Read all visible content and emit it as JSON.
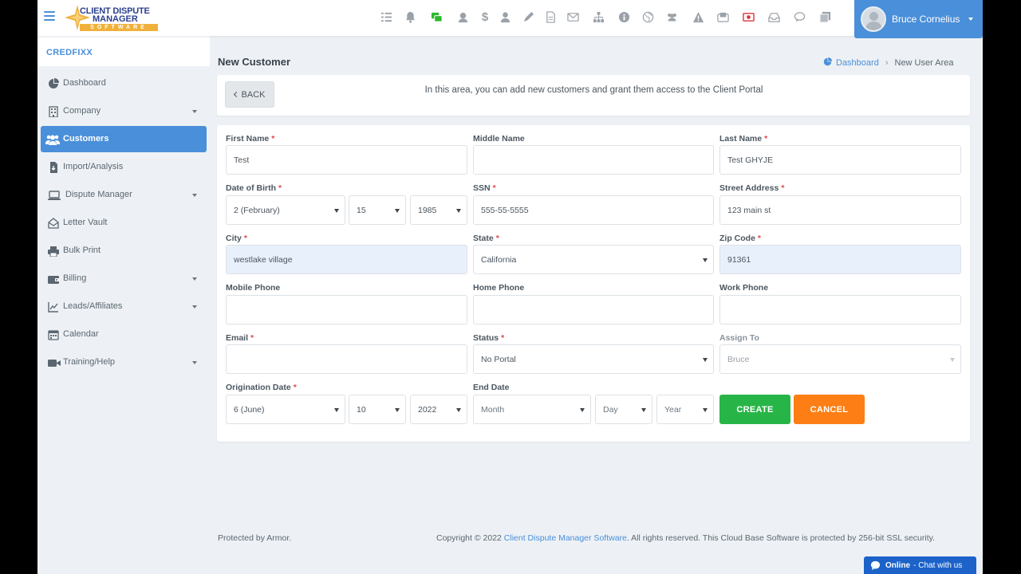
{
  "header": {
    "logo_line1": "CLIENT DISPUTE",
    "logo_line2": "MANAGER",
    "logo_line3": "SOFTWARE",
    "user_name": "Bruce Cornelius",
    "icons": [
      "tasks-icon",
      "bell-icon",
      "disputes-icon",
      "agent-icon",
      "dollar-icon",
      "user-tie-icon",
      "pen-icon",
      "file-icon",
      "envelope-icon",
      "sitemap-icon",
      "info-icon",
      "globe-icon",
      "users-icon",
      "warning-icon",
      "mail-box-icon",
      "money-icon",
      "inbox-icon",
      "comments-icon",
      "copy-icon"
    ]
  },
  "sidebar": {
    "brand": "CREDFIXX",
    "items": [
      {
        "label": "Dashboard",
        "icon": "pie-chart-icon",
        "has_caret": false,
        "active": false
      },
      {
        "label": "Company",
        "icon": "building-icon",
        "has_caret": true,
        "active": false
      },
      {
        "label": "Customers",
        "icon": "users-icon",
        "has_caret": false,
        "active": true
      },
      {
        "label": "Import/Analysis",
        "icon": "file-import-icon",
        "has_caret": false,
        "active": false
      },
      {
        "label": "Dispute Manager",
        "icon": "laptop-icon",
        "has_caret": true,
        "active": false
      },
      {
        "label": "Letter Vault",
        "icon": "envelope-open-icon",
        "has_caret": false,
        "active": false
      },
      {
        "label": "Bulk Print",
        "icon": "print-icon",
        "has_caret": false,
        "active": false
      },
      {
        "label": "Billing",
        "icon": "wallet-icon",
        "has_caret": true,
        "active": false
      },
      {
        "label": "Leads/Affiliates",
        "icon": "chart-line-icon",
        "has_caret": true,
        "active": false
      },
      {
        "label": "Calendar",
        "icon": "calendar-icon",
        "has_caret": false,
        "active": false
      },
      {
        "label": "Training/Help",
        "icon": "video-icon",
        "has_caret": true,
        "active": false
      }
    ]
  },
  "page": {
    "title": "New Customer",
    "breadcrumb": {
      "home": "Dashboard",
      "current": "New User Area"
    },
    "back_label": "BACK",
    "info_text": "In this area, you can add new customers and grant them access to the Client Portal"
  },
  "form": {
    "first_name": {
      "label": "First Name",
      "value": "Test"
    },
    "middle_name": {
      "label": "Middle Name",
      "value": ""
    },
    "last_name": {
      "label": "Last Name",
      "value": "Test GHYJE"
    },
    "dob": {
      "label": "Date of Birth",
      "month": "2 (February)",
      "day": "15",
      "year": "1985"
    },
    "ssn": {
      "label": "SSN",
      "value": "555-55-5555"
    },
    "street": {
      "label": "Street Address",
      "value": "123 main st"
    },
    "city": {
      "label": "City",
      "value": "westlake village"
    },
    "state": {
      "label": "State",
      "value": "California"
    },
    "zip": {
      "label": "Zip Code",
      "value": "91361"
    },
    "mobile": {
      "label": "Mobile Phone",
      "value": ""
    },
    "home_phone": {
      "label": "Home Phone",
      "value": ""
    },
    "work_phone": {
      "label": "Work Phone",
      "value": ""
    },
    "email": {
      "label": "Email",
      "value": ""
    },
    "status": {
      "label": "Status",
      "value": "No Portal"
    },
    "assign_to": {
      "label": "Assign To",
      "value": "Bruce"
    },
    "origination": {
      "label": "Origination Date",
      "month": "6 (June)",
      "day": "10",
      "year": "2022"
    },
    "end_date": {
      "label": "End Date",
      "month": "Month",
      "day": "Day",
      "year": "Year"
    },
    "create_label": "CREATE",
    "cancel_label": "CANCEL"
  },
  "footer": {
    "left": "Protected by Armor.",
    "right_prefix": "Copyright © 2022 ",
    "right_link": "Client Dispute Manager Software",
    "right_suffix": ". All rights reserved. This Cloud Base Software is protected by 256-bit SSL security."
  },
  "chat": {
    "status": "Online",
    "text": "- Chat with us"
  },
  "colors": {
    "primary": "#4a8fd9",
    "create": "#28b547",
    "cancel": "#fd7e14",
    "required": "#e0474c"
  }
}
